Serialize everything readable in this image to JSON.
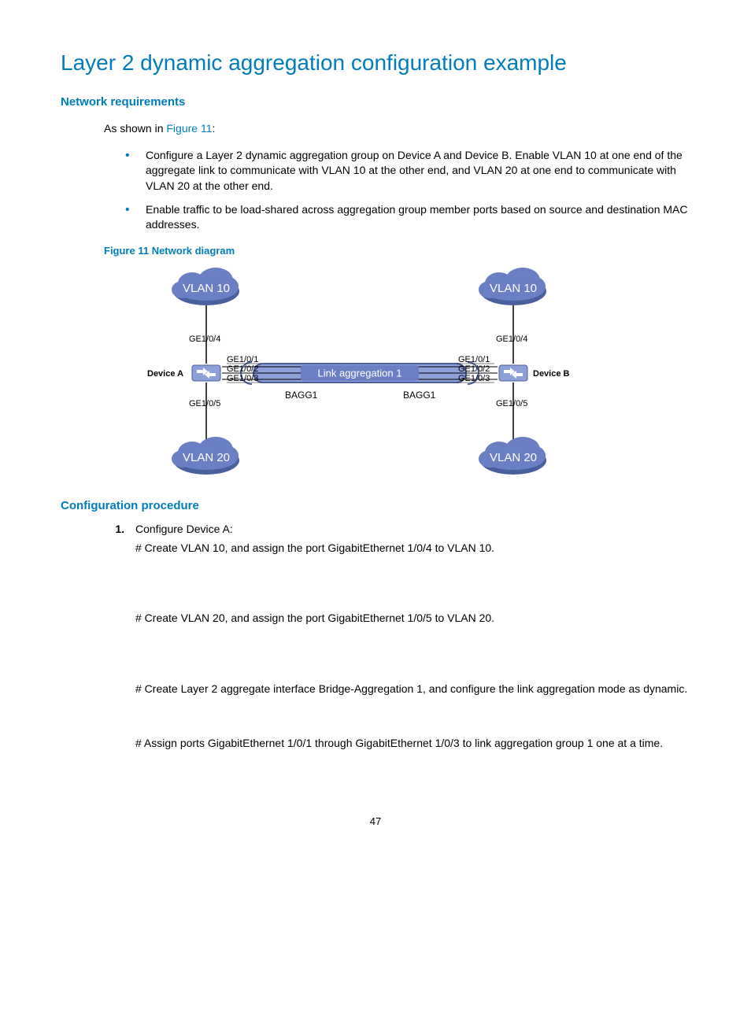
{
  "title": "Layer 2 dynamic aggregation configuration example",
  "sec1": {
    "heading": "Network requirements",
    "intro_pre": "As shown in ",
    "intro_link": "Figure 11",
    "intro_post": ":",
    "bullets": [
      "Configure a Layer 2 dynamic aggregation group on Device A and Device B. Enable VLAN 10 at one end of the aggregate link to communicate with VLAN 10 at the other end, and VLAN 20 at one end to communicate with VLAN 20 at the other end.",
      "Enable traffic to be load-shared across aggregation group member ports based on source and destination MAC addresses."
    ],
    "figcap": "Figure 11 Network diagram"
  },
  "diagram": {
    "vlan10": "VLAN 10",
    "vlan20": "VLAN 20",
    "deviceA": "Device A",
    "deviceB": "Device B",
    "ge104": "GE1/0/4",
    "ge105": "GE1/0/5",
    "ge101": "GE1/0/1",
    "ge102": "GE1/0/2",
    "ge103": "GE1/0/3",
    "linkagg": "Link aggregation 1",
    "bagg1": "BAGG1"
  },
  "sec2": {
    "heading": "Configuration procedure",
    "step1_title": "Configure Device A:",
    "p1": "# Create VLAN 10, and assign the port GigabitEthernet 1/0/4 to VLAN 10.",
    "p2": "# Create VLAN 20, and assign the port GigabitEthernet 1/0/5 to VLAN 20.",
    "p3": "# Create Layer 2 aggregate interface Bridge-Aggregation 1, and configure the link aggregation mode as dynamic.",
    "p4": "# Assign ports GigabitEthernet 1/0/1 through GigabitEthernet 1/0/3 to link aggregation group 1 one at a time."
  },
  "pagenum": "47"
}
